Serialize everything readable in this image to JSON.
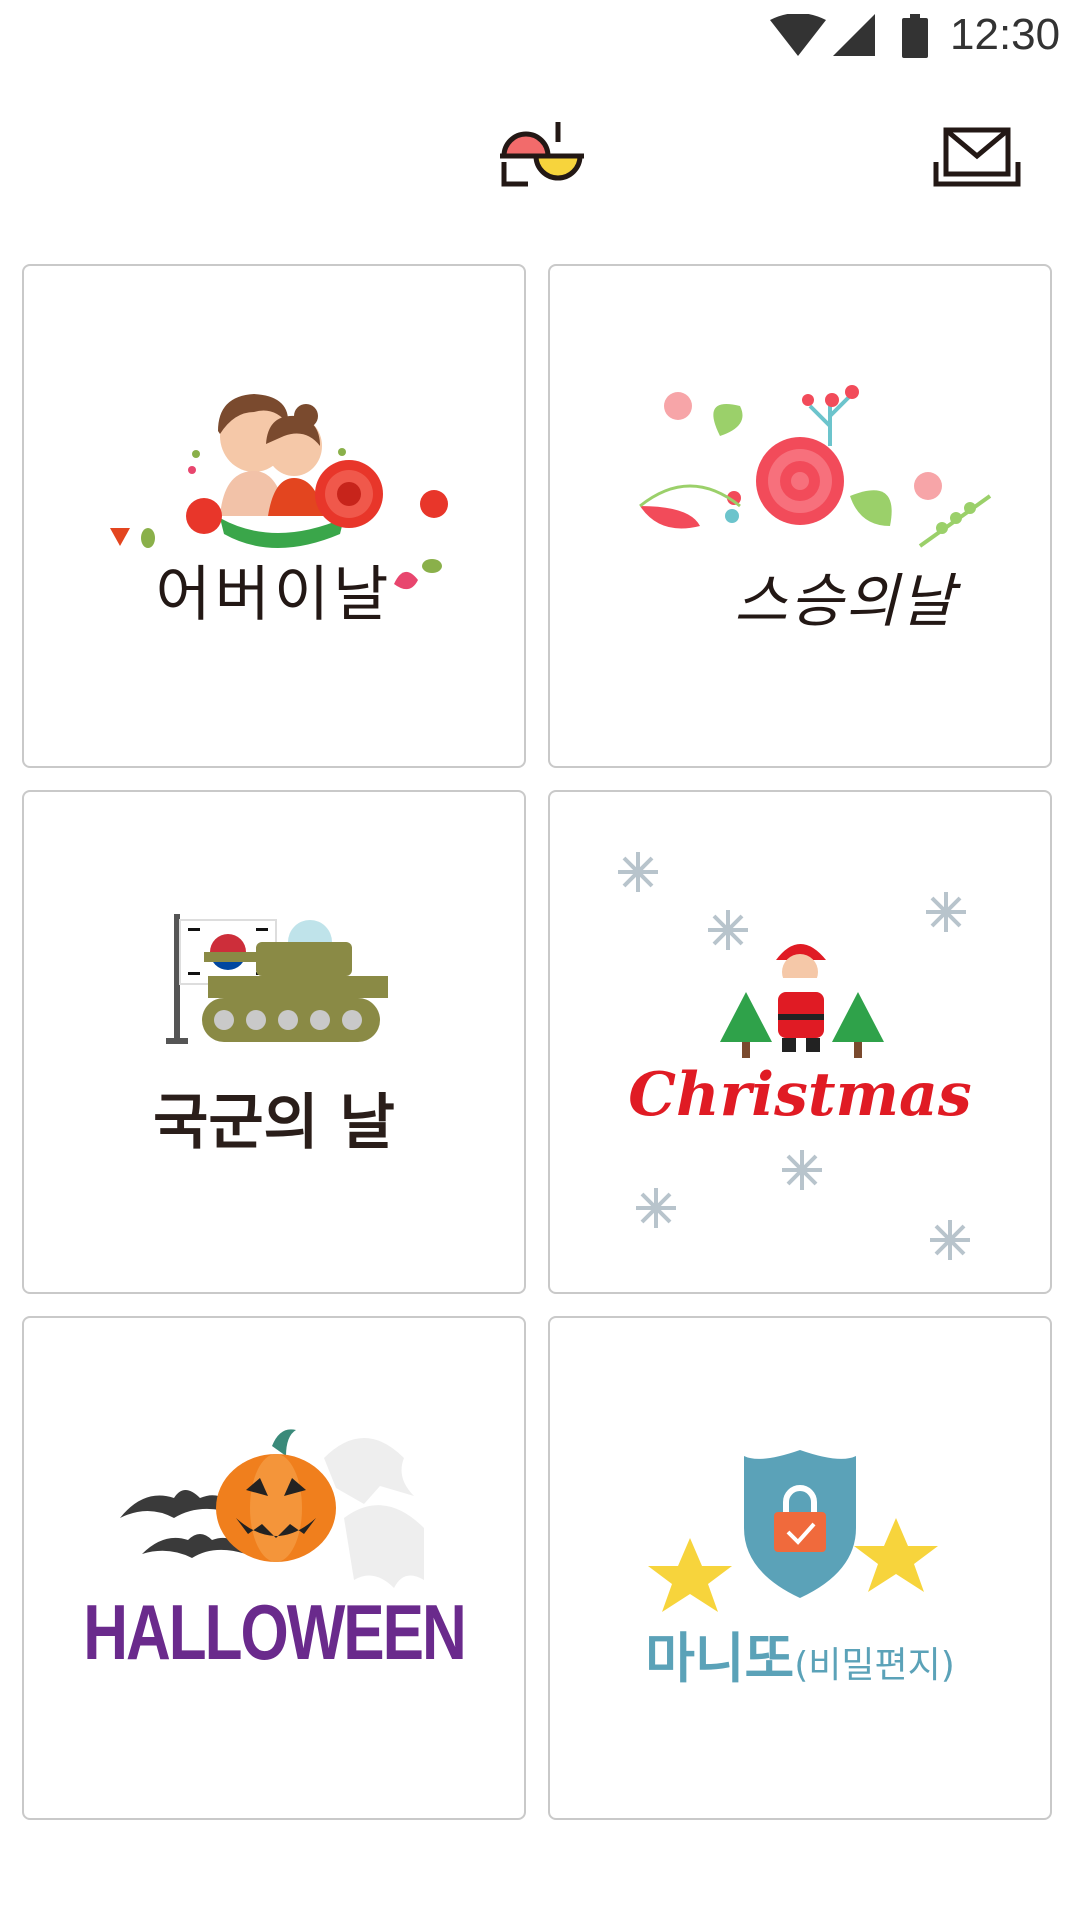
{
  "status_bar": {
    "time": "12:30",
    "icons": [
      "wifi-icon",
      "signal-icon",
      "battery-icon"
    ]
  },
  "header": {
    "logo_icon": "app-logo-icon",
    "mail_icon": "mailbox-icon"
  },
  "cards": [
    {
      "id": "parents-day",
      "label": "어버이날"
    },
    {
      "id": "teachers-day",
      "label": "스승의날"
    },
    {
      "id": "armed-forces-day",
      "label": "국군의 날"
    },
    {
      "id": "christmas",
      "label": "Christmas"
    },
    {
      "id": "halloween",
      "label": "HALLOWEEN"
    },
    {
      "id": "manito",
      "label": "마니또",
      "sublabel": "(비밀편지)"
    }
  ],
  "colors": {
    "card_border": "#c9c9c9",
    "christmas_red": "#e01b24",
    "halloween_purple": "#6a2a8c",
    "manito_blue": "#5ba2b8",
    "logo_red": "#f26b6b",
    "logo_yellow": "#f7d43c"
  }
}
